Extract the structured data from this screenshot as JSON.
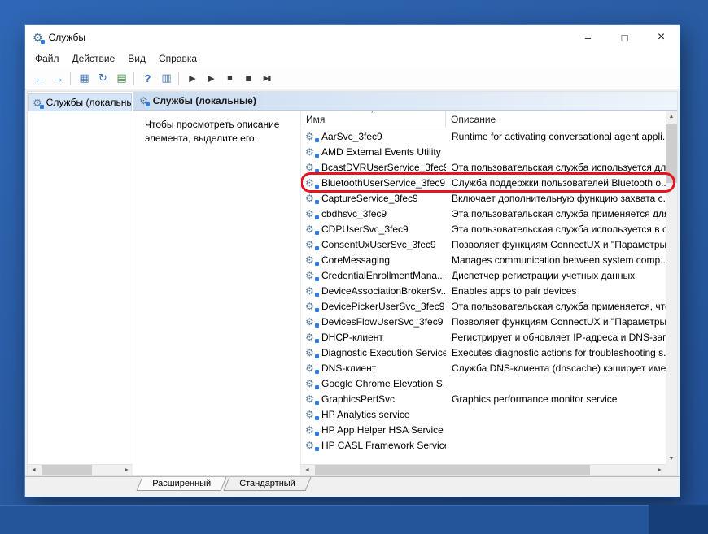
{
  "icons": {
    "gear": "⚙",
    "sort_ascending": "^",
    "scroll_up": "▲",
    "scroll_down": "▼",
    "scroll_left": "◄",
    "scroll_right": "►"
  },
  "colors": {
    "highlight_oval": "#e41420",
    "desktop": "#28599f",
    "selection": "#d6e6f8"
  },
  "window": {
    "title": "Службы",
    "minimize": "–",
    "maximize": "□",
    "close": "×"
  },
  "menu": [
    "Файл",
    "Действие",
    "Вид",
    "Справка"
  ],
  "toolbar": [
    {
      "name": "back-icon",
      "glyph": "←",
      "color": "#2f6fc1"
    },
    {
      "name": "forward-icon",
      "glyph": "→",
      "color": "#2f6fc1"
    },
    {
      "separator": true
    },
    {
      "name": "show-console-tree-icon",
      "glyph": "▦",
      "color": "#4a7ab5"
    },
    {
      "name": "refresh-icon",
      "glyph": "↻",
      "color": "#2f6fc1"
    },
    {
      "name": "export-list-icon",
      "glyph": "▤",
      "color": "#3f8a46"
    },
    {
      "separator": true
    },
    {
      "name": "help-icon",
      "glyph": "?",
      "color": "#2f6fc1"
    },
    {
      "name": "show-action-pane-icon",
      "glyph": "▥",
      "color": "#4a7ab5"
    },
    {
      "separator": true
    },
    {
      "name": "start-service-icon",
      "glyph": "▶",
      "color": "#3a3a3a"
    },
    {
      "name": "resume-service-icon",
      "glyph": "▶",
      "color": "#3a3a3a"
    },
    {
      "name": "stop-service-icon",
      "glyph": "■",
      "color": "#3a3a3a"
    },
    {
      "name": "pause-service-icon",
      "glyph": "▮▮",
      "color": "#3a3a3a"
    },
    {
      "name": "restart-service-icon",
      "glyph": "▶▮",
      "color": "#3a3a3a"
    }
  ],
  "tree": {
    "root_label": "Службы (локальные)"
  },
  "main": {
    "header": "Службы (локальные)",
    "hint": "Чтобы просмотреть описание элемента, выделите его.",
    "col_name": "Имя",
    "col_desc": "Описание"
  },
  "services": [
    {
      "name": "AarSvc_3fec9",
      "description": "Runtime for activating conversational agent appli..."
    },
    {
      "name": "AMD External Events Utility",
      "description": ""
    },
    {
      "name": "BcastDVRUserService_3fec9",
      "description": "Эта пользовательская служба используется дл..."
    },
    {
      "name": "BluetoothUserService_3fec9",
      "description": "Служба поддержки пользователей Bluetooth о...",
      "highlighted": true
    },
    {
      "name": "CaptureService_3fec9",
      "description": "Включает дополнительную функцию захвата с..."
    },
    {
      "name": "cbdhsvc_3fec9",
      "description": "Эта пользовательская служба применяется для..."
    },
    {
      "name": "CDPUserSvc_3fec9",
      "description": "Эта пользовательская служба используется в с..."
    },
    {
      "name": "ConsentUxUserSvc_3fec9",
      "description": "Позволяет функциям ConnectUX и \"Параметры..."
    },
    {
      "name": "CoreMessaging",
      "description": "Manages communication between system comp..."
    },
    {
      "name": "CredentialEnrollmentMana...",
      "description": "Диспетчер регистрации учетных данных"
    },
    {
      "name": "DeviceAssociationBrokerSv...",
      "description": "Enables apps to pair devices"
    },
    {
      "name": "DevicePickerUserSvc_3fec9",
      "description": "Эта пользовательская служба применяется, что..."
    },
    {
      "name": "DevicesFlowUserSvc_3fec9",
      "description": "Позволяет функциям ConnectUX и \"Параметры..."
    },
    {
      "name": "DHCP-клиент",
      "description": "Регистрирует и обновляет IP-адреса и DNS-зап..."
    },
    {
      "name": "Diagnostic Execution Service",
      "description": "Executes diagnostic actions for troubleshooting s..."
    },
    {
      "name": "DNS-клиент",
      "description": "Служба DNS-клиента (dnscache) кэширует име..."
    },
    {
      "name": "Google Chrome Elevation S...",
      "description": ""
    },
    {
      "name": "GraphicsPerfSvc",
      "description": "Graphics performance monitor service"
    },
    {
      "name": "HP Analytics service",
      "description": ""
    },
    {
      "name": "HP App Helper HSA Service",
      "description": ""
    },
    {
      "name": "HP CASL Framework Service",
      "description": ""
    }
  ],
  "tabs": [
    {
      "label": "Расширенный",
      "active": true
    },
    {
      "label": "Стандартный",
      "active": false
    }
  ]
}
